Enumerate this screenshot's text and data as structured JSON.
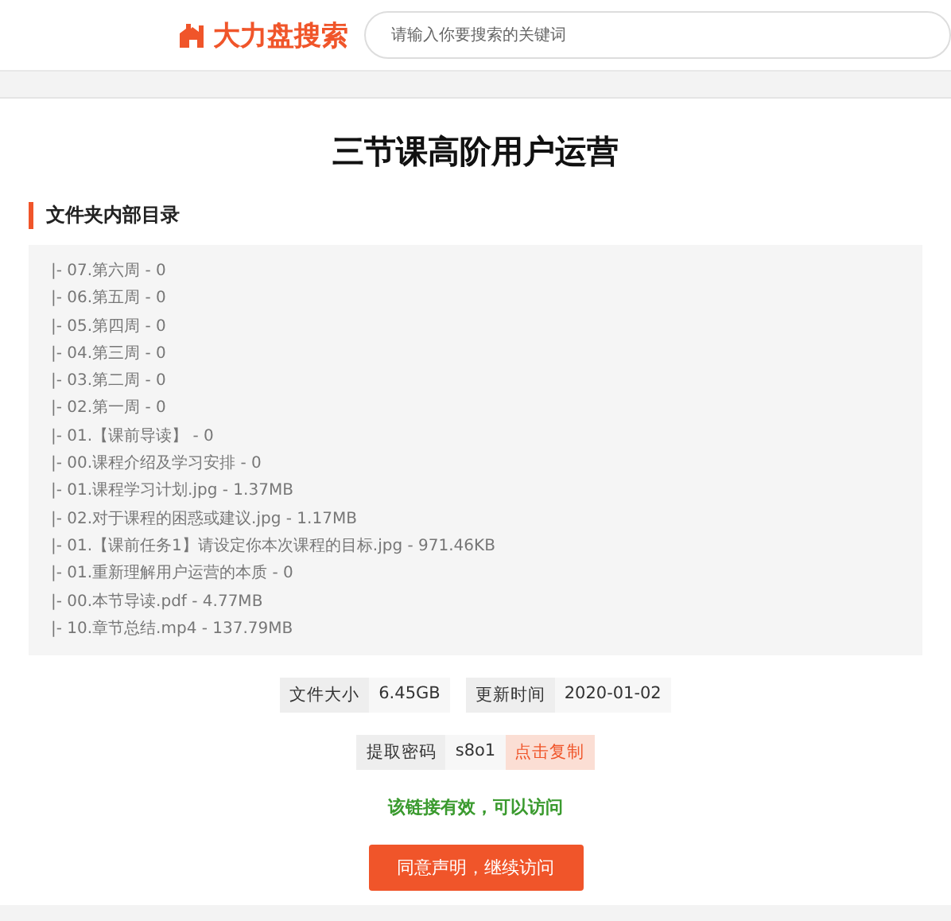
{
  "header": {
    "logo": "大力盘搜索",
    "search": {
      "placeholder": "请输入你要搜索的关键词"
    }
  },
  "title": "三节课高阶用户运营",
  "section_heading": "文件夹内部目录",
  "files": [
    "|- 07.第六周 - 0",
    "|- 06.第五周 - 0",
    "|- 05.第四周 - 0",
    "|- 04.第三周 - 0",
    "|- 03.第二周 - 0",
    "|- 02.第一周 - 0",
    "|- 01.【课前导读】 - 0",
    "|- 00.课程介绍及学习安排 - 0",
    "|- 01.课程学习计划.jpg - 1.37MB",
    "|- 02.对于课程的困惑或建议.jpg - 1.17MB",
    "|- 01.【课前任务1】请设定你本次课程的目标.jpg - 971.46KB",
    "|- 01.重新理解用户运营的本质 - 0",
    "|- 00.本节导读.pdf - 4.77MB",
    "|- 10.章节总结.mp4 - 137.79MB"
  ],
  "info": [
    {
      "label": "文件大小",
      "value": "6.45GB"
    },
    {
      "label": "更新时间",
      "value": "2020-01-02"
    }
  ],
  "password": {
    "label": "提取密码",
    "value": "s8o1",
    "copy": "点击复制"
  },
  "status": "该链接有效，可以访问",
  "button": "同意声明，继续访问"
}
